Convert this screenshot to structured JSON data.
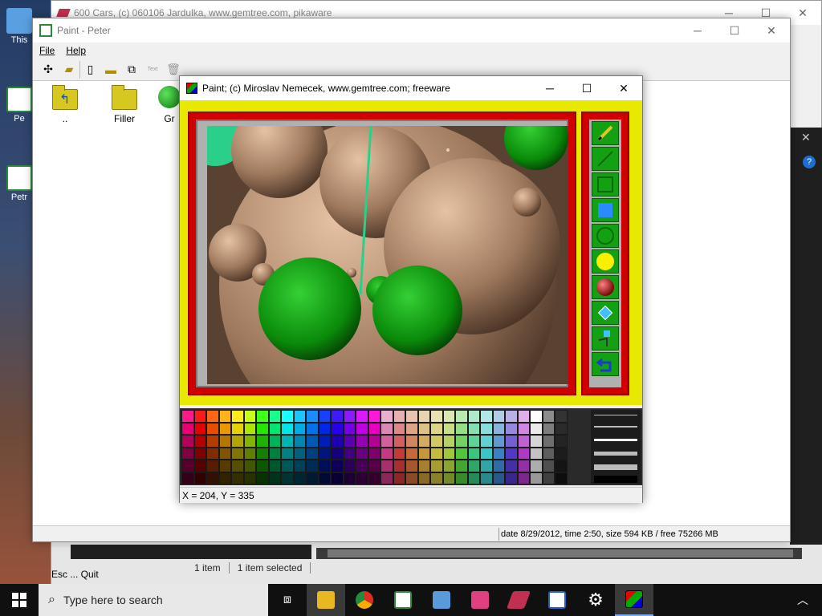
{
  "desktop": {
    "icons": [
      {
        "label": "This",
        "color": "#5aa0e0"
      },
      {
        "label": "Pe",
        "color": "#2a8a3a"
      },
      {
        "label": "Petr",
        "color": "#2a8a3a"
      }
    ]
  },
  "cars_window": {
    "title": "600 Cars, (c) 060106 Jardulka, www.gemtree.com, pikaware",
    "status_items": "1 item",
    "status_selected": "1 item selected",
    "quit_hint": "Esc ... Quit"
  },
  "explorer_window": {
    "title": "Paint - Peter",
    "menu": [
      "File",
      "Help"
    ],
    "toolbar_text_label": "Text",
    "files": [
      {
        "label": ".."
      },
      {
        "label": "Filler"
      },
      {
        "label": "Gr"
      }
    ],
    "status_info": "date 8/29/2012, time 2:50, size 594 KB / free 75266 MB"
  },
  "paint_window": {
    "title": "Paint;   (c) Miroslav Nemecek, www.gemtree.com;   freeware",
    "coords": "X = 204, Y = 335",
    "frame_color": "#e8e800",
    "border_color": "#d00000",
    "tools": [
      "pencil-tool",
      "line-tool",
      "rectangle-tool",
      "filled-rectangle-tool",
      "circle-tool",
      "filled-circle-tool",
      "sphere-tool",
      "fill-tool",
      "spray-tool",
      "undo-tool"
    ]
  },
  "taskbar": {
    "search_placeholder": "Type here to search"
  }
}
